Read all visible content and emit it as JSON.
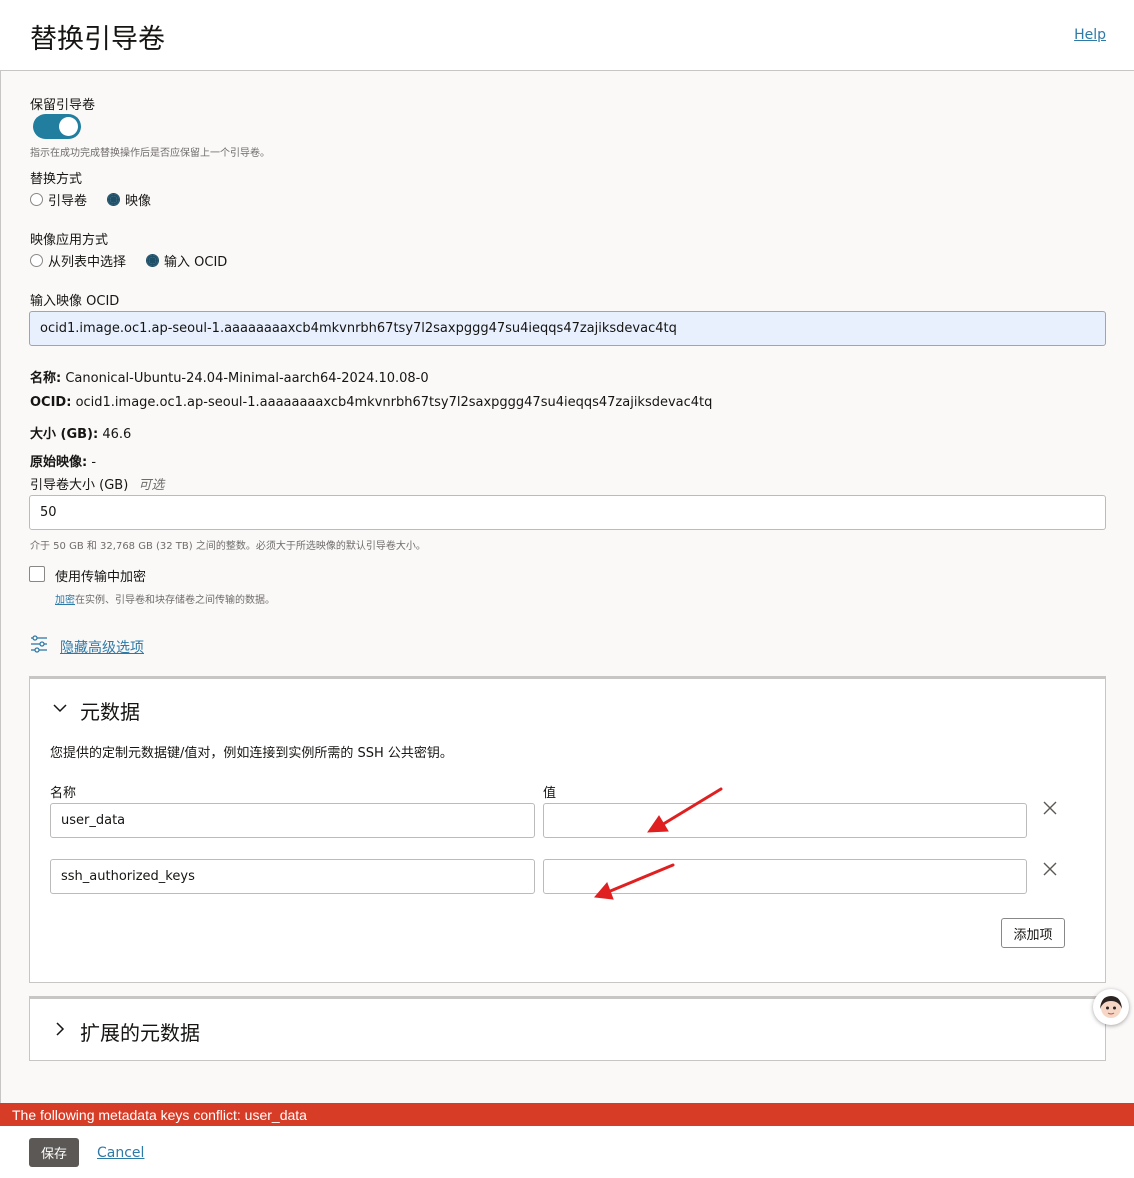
{
  "header": {
    "title": "替换引导卷",
    "help_label": "Help"
  },
  "preserve": {
    "label": "保留引导卷",
    "enabled": true,
    "hint": "指示在成功完成替换操作后是否应保留上一个引导卷。"
  },
  "replace_by": {
    "label": "替换方式",
    "options": [
      "引导卷",
      "映像"
    ],
    "selected": "映像"
  },
  "image_apply": {
    "label": "映像应用方式",
    "options": [
      "从列表中选择",
      "输入 OCID"
    ],
    "selected": "输入 OCID"
  },
  "ocid_input": {
    "label": "输入映像 OCID",
    "value": "ocid1.image.oc1.ap-seoul-1.aaaaaaaaxcb4mkvnrbh67tsy7l2saxpggg47su4ieqqs47zajiksdevac4tq"
  },
  "image_info": {
    "name_label": "名称:",
    "name_value": "Canonical-Ubuntu-24.04-Minimal-aarch64-2024.10.08-0",
    "ocid_label": "OCID:",
    "ocid_value": "ocid1.image.oc1.ap-seoul-1.aaaaaaaaxcb4mkvnrbh67tsy7l2saxpggg47su4ieqqs47zajiksdevac4tq",
    "size_label": "大小 (GB):",
    "size_value": "46.6",
    "source_label": "原始映像:",
    "source_value": "-"
  },
  "boot_size": {
    "label": "引导卷大小 (GB)",
    "optional": "可选",
    "value": "50",
    "hint": "介于 50 GB 和 32,768 GB (32 TB) 之间的整数。必须大于所选映像的默认引导卷大小。"
  },
  "encryption": {
    "label": "使用传输中加密",
    "hint_link": "加密",
    "hint_rest": "在实例、引导卷和块存储卷之间传输的数据。"
  },
  "advanced": {
    "label": "隐藏高级选项"
  },
  "metadata": {
    "title": "元数据",
    "description": "您提供的定制元数据键/值对，例如连接到实例所需的 SSH 公共密钥。",
    "name_header": "名称",
    "value_header": "值",
    "rows": [
      {
        "name": "user_data",
        "value": ""
      },
      {
        "name": "ssh_authorized_keys",
        "value": ""
      }
    ],
    "add_label": "添加项"
  },
  "extended": {
    "title": "扩展的元数据"
  },
  "error": {
    "message": "The following metadata keys conflict: user_data"
  },
  "footer": {
    "save_label": "保存",
    "cancel_label": "Cancel"
  },
  "colors": {
    "accent": "#227e9e",
    "error": "#d73c27",
    "link": "#2e7aa7",
    "annotation_arrow": "#e02020"
  }
}
